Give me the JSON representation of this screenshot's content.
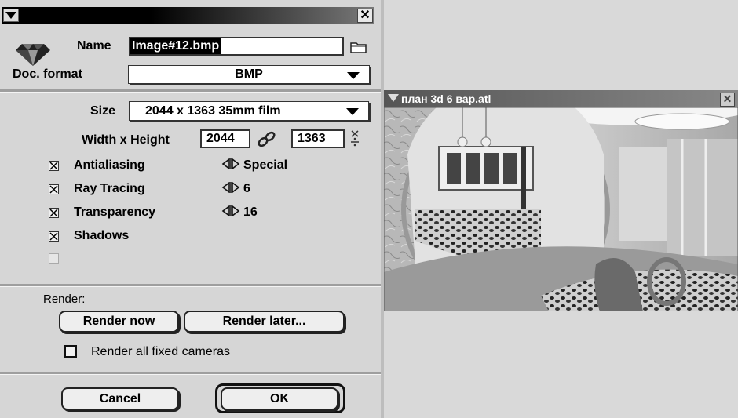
{
  "dialog": {
    "close_glyph": "✕",
    "name_label": "Name",
    "name_value": "Image#12.bmp",
    "doc_format_label": "Doc. format",
    "doc_format_value": "BMP",
    "size_label": "Size",
    "size_value": "2044 x 1363  35mm film",
    "wh_label": "Width x Height",
    "width_value": "2044",
    "height_value": "1363",
    "options": [
      {
        "label": "Antialiasing",
        "checked": true,
        "setting": "Special"
      },
      {
        "label": "Ray Tracing",
        "checked": true,
        "setting": "6"
      },
      {
        "label": "Transparency",
        "checked": true,
        "setting": "16"
      },
      {
        "label": "Shadows",
        "checked": true
      }
    ],
    "render_label": "Render:",
    "render_now": "Render now",
    "render_later": "Render later...",
    "render_all_cameras": "Render all fixed cameras",
    "render_all_checked": false,
    "cancel": "Cancel",
    "ok": "OK"
  },
  "render_window": {
    "title": "план 3d 6 вар.atl",
    "close_glyph": "✕"
  },
  "colors": {
    "titlebar": "#000000",
    "panel": "#d6d6d6",
    "background": "#d9d9d9"
  }
}
